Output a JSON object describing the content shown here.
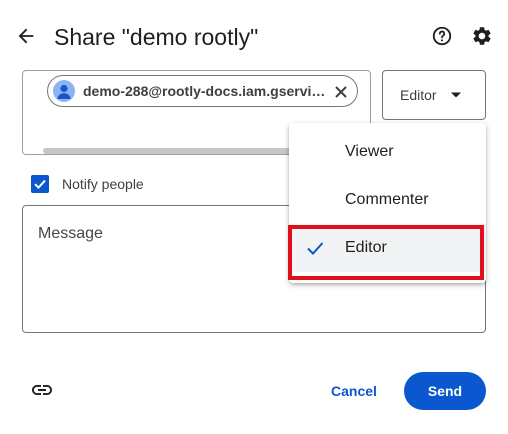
{
  "dialog": {
    "title": "Share \"demo rootly\""
  },
  "header_icons": [
    "back-arrow-icon",
    "help-icon",
    "settings-gear-icon"
  ],
  "recipients": {
    "chips": [
      {
        "label": "demo-288@rootly-docs.iam.gservic..."
      }
    ]
  },
  "role_select": {
    "value": "Editor"
  },
  "notify": {
    "label": "Notify people",
    "checked": true
  },
  "message": {
    "placeholder": "Message"
  },
  "footer": {
    "cancel_label": "Cancel",
    "send_label": "Send"
  },
  "role_menu": {
    "items": [
      {
        "label": "Viewer",
        "selected": false
      },
      {
        "label": "Commenter",
        "selected": false
      },
      {
        "label": "Editor",
        "selected": true
      }
    ]
  },
  "colors": {
    "accent": "#0b57d0",
    "highlight_border": "#e0101b"
  }
}
